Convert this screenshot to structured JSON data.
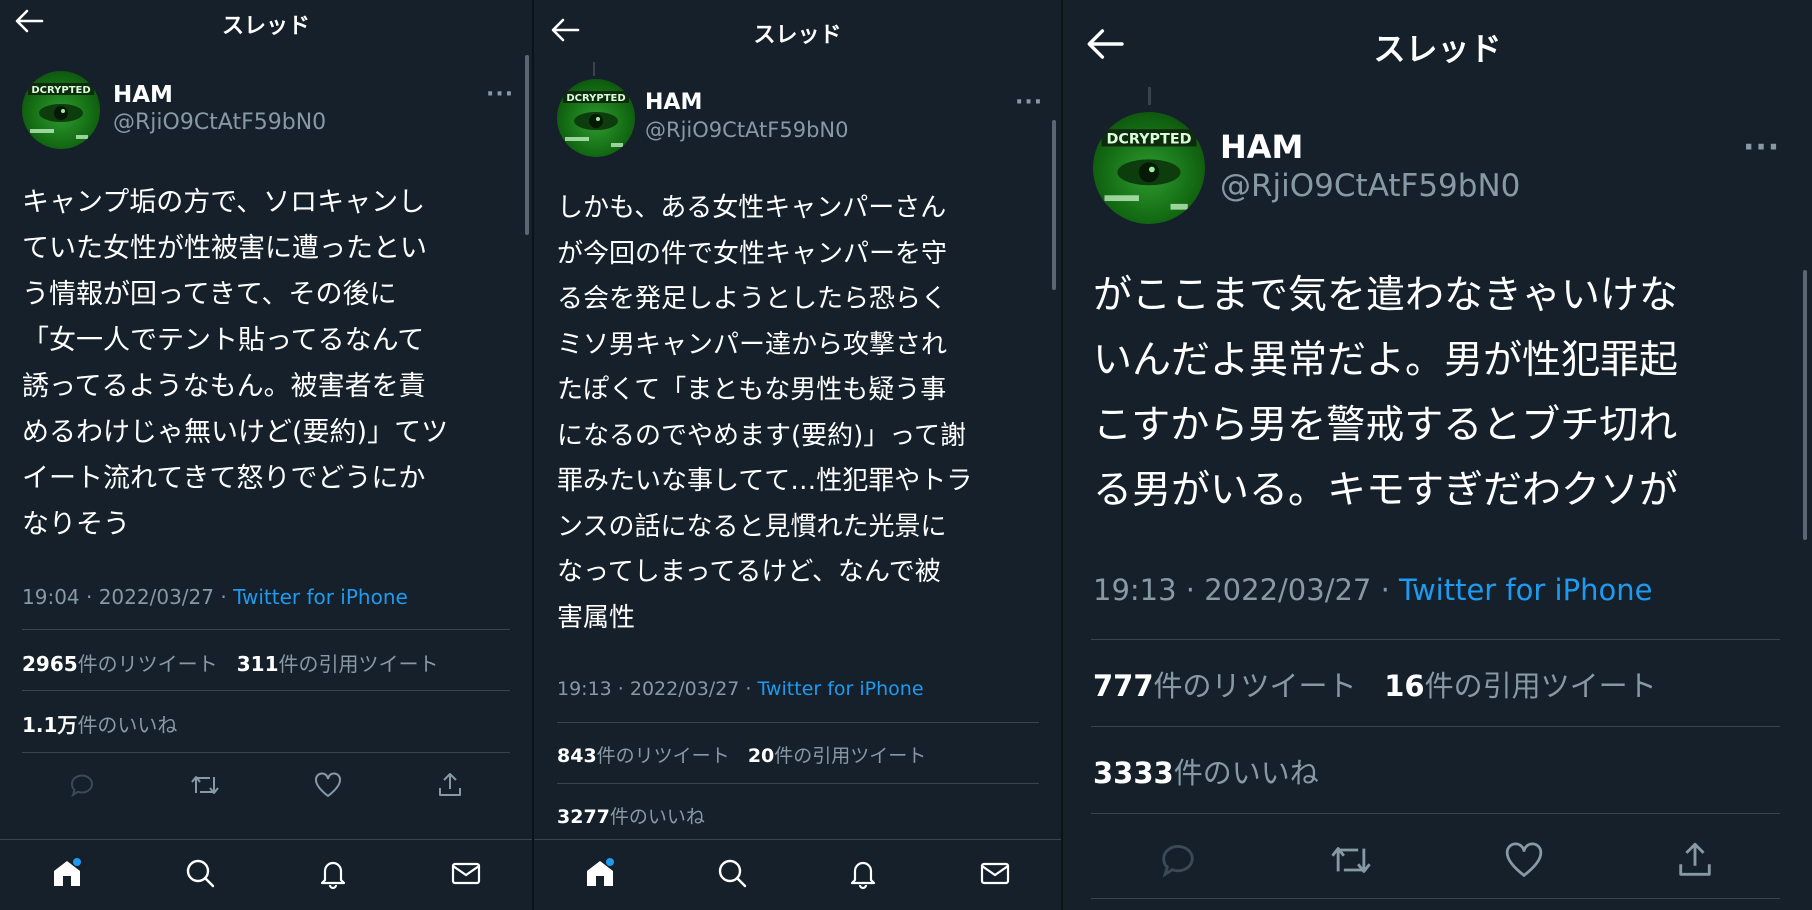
{
  "header_title": "スレッド",
  "user": {
    "name": "HAM",
    "handle": "@RjiO9CtAtF59bN0",
    "avatar_text": "DCRYPTED"
  },
  "tweets": [
    {
      "text": "キャンプ垢の方で、ソロキャンし\nていた女性が性被害に遭ったとい\nう情報が回ってきて、その後に\n「女一人でテント貼ってるなんて\n誘ってるようなもん。被害者を責\nめるわけじゃ無いけど(要約)」てツ\nイート流れてきて怒りでどうにか\nなりそう",
      "time": "19:04 · 2022/03/27 · ",
      "source": "Twitter for iPhone",
      "retweets": "2965",
      "retweets_label": "件のリツイート",
      "quotes": "311",
      "quotes_label": "件の引用ツイート",
      "likes": "1.1万",
      "likes_label": "件のいいね"
    },
    {
      "text": "しかも、ある女性キャンパーさん\nが今回の件で女性キャンパーを守\nる会を発足しようとしたら恐らく\nミソ男キャンパー達から攻撃され\nたぽくて「まともな男性も疑う事\nになるのでやめます(要約)」って謝\n罪みたいな事してて…性犯罪やトラ\nンスの話になると見慣れた光景に\nなってしまってるけど、なんで被\n害属性",
      "time": "19:13 · 2022/03/27 · ",
      "source": "Twitter for iPhone",
      "retweets": "843",
      "retweets_label": "件のリツイート",
      "quotes": "20",
      "quotes_label": "件の引用ツイート",
      "likes": "3277",
      "likes_label": "件のいいね"
    },
    {
      "text": "がここまで気を遣わなきゃいけな\nいんだよ異常だよ。男が性犯罪起\nこすから男を警戒するとブチ切れ\nる男がいる。キモすぎだわクソが",
      "time": "19:13 · 2022/03/27 · ",
      "source": "Twitter for iPhone",
      "retweets": "777",
      "retweets_label": "件のリツイート",
      "quotes": "16",
      "quotes_label": "件の引用ツイート",
      "likes": "3333",
      "likes_label": "件のいいね"
    }
  ],
  "icons": {
    "back": "arrow-left-icon",
    "more": "more-dots-icon",
    "reply": "reply-icon",
    "retweet": "retweet-icon",
    "like": "heart-icon",
    "share": "share-icon",
    "nav": [
      "home-icon",
      "search-icon",
      "bell-icon",
      "mail-icon"
    ]
  },
  "colors": {
    "background": "#15202b",
    "accent": "#1d9bf0",
    "muted": "#8899a6",
    "avatar": "#1f8f1f"
  }
}
